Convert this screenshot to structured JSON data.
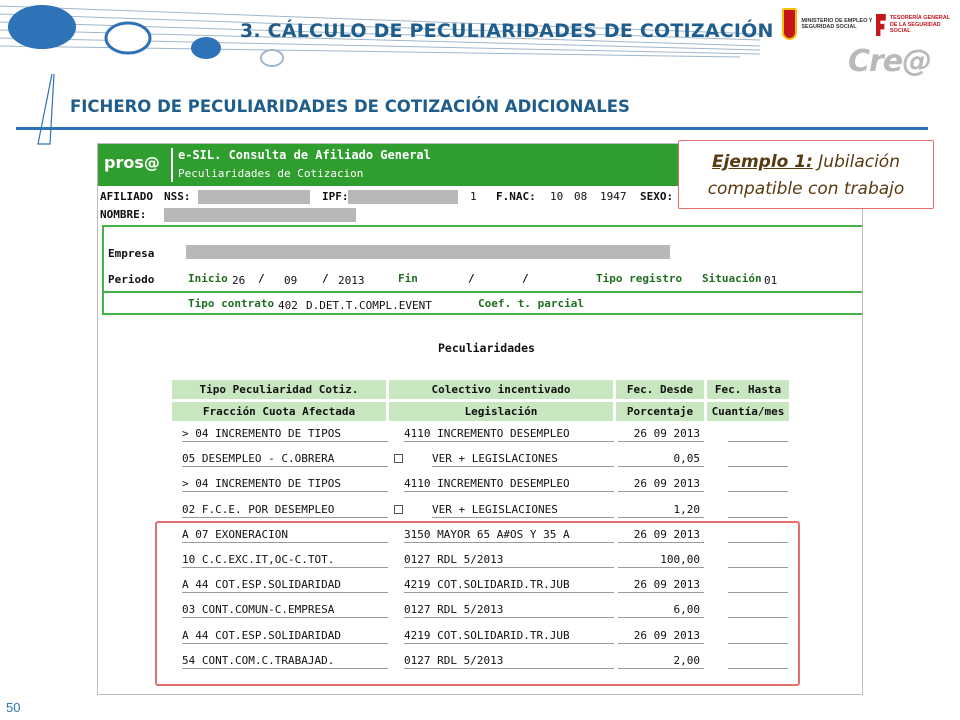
{
  "slide": {
    "title": "3.  CÁLCULO DE PECULIARIDADES DE COTIZACIÓN",
    "subtitle": "FICHERO DE PECULIARIDADES DE COTIZACIÓN ADICIONALES",
    "page_number": "50",
    "logo_ministry_text": "MINISTERIO DE EMPLEO Y SEGURIDAD SOCIAL",
    "logo_ss_text": "TESORERÍA GENERAL DE LA SEGURIDAD SOCIAL",
    "logo_crea": "Cre@"
  },
  "callout": {
    "label": "Ejemplo 1:",
    "text_1": "Jubilación",
    "text_2": "compatible con trabajo"
  },
  "app": {
    "brand": "pros@",
    "title": "e-SIL. Consulta de Afiliado General",
    "subtitle": "Peculiaridades de Cotizacion"
  },
  "affiliate": {
    "afiliado_label": "AFILIADO",
    "nss_label": "NSS:",
    "ipf_label": "IPF:",
    "ipf_suffix": "1",
    "fnac_label": "F.NAC:",
    "fnac_day": "10",
    "fnac_month": "08",
    "fnac_year": "1947",
    "sexo_label": "SEXO:",
    "nombre_label": "NOMBRE:"
  },
  "empresa": {
    "empresa_label": "Empresa",
    "periodo_label": "Periodo",
    "inicio_label": "Inicio",
    "inicio_day": "26",
    "inicio_month": "09",
    "inicio_year": "2013",
    "slash": "/",
    "fin_label": "Fin",
    "tipo_registro_label": "Tipo registro",
    "situacion_label": "Situación",
    "situacion_value": "01",
    "tipo_contrato_label": "Tipo contrato",
    "tipo_contrato_code": "402",
    "tipo_contrato_desc": "D.DET.T.COMPL.EVENT",
    "coef_label": "Coef. t. parcial"
  },
  "peculiaridades": {
    "title": "Peculiaridades",
    "headers_row1": [
      "Tipo Peculiaridad Cotiz.",
      "Colectivo incentivado",
      "Fec. Desde",
      "Fec. Hasta"
    ],
    "headers_row2": [
      "Fracción Cuota Afectada",
      "Legislación",
      "Porcentaje",
      "Cuantía/mes"
    ],
    "rows": [
      {
        "c1": "> 04 INCREMENTO DE TIPOS",
        "c2": "4110 INCREMENTO DESEMPLEO",
        "c3": "26 09 2013",
        "c4": "",
        "check": false
      },
      {
        "c1": "05 DESEMPLEO - C.OBRERA",
        "c2": "VER + LEGISLACIONES",
        "c3": "0,05",
        "c4": "",
        "check": true
      },
      {
        "c1": "> 04 INCREMENTO DE TIPOS",
        "c2": "4110 INCREMENTO DESEMPLEO",
        "c3": "26 09 2013",
        "c4": "",
        "check": false
      },
      {
        "c1": "02 F.C.E. POR DESEMPLEO",
        "c2": "VER + LEGISLACIONES",
        "c3": "1,20",
        "c4": "",
        "check": true
      },
      {
        "c1": "A 07 EXONERACION",
        "c2": "3150 MAYOR 65 A#OS Y 35 A",
        "c3": "26 09 2013",
        "c4": "",
        "check": false
      },
      {
        "c1": "10 C.C.EXC.IT,OC-C.TOT.",
        "c2": "0127 RDL 5/2013",
        "c3": "100,00",
        "c4": "",
        "check": false
      },
      {
        "c1": "A 44 COT.ESP.SOLIDARIDAD",
        "c2": "4219 COT.SOLIDARID.TR.JUB",
        "c3": "26 09 2013",
        "c4": "",
        "check": false
      },
      {
        "c1": "03 CONT.COMUN-C.EMPRESA",
        "c2": "0127 RDL 5/2013",
        "c3": "6,00",
        "c4": "",
        "check": false
      },
      {
        "c1": "A 44 COT.ESP.SOLIDARIDAD",
        "c2": "4219 COT.SOLIDARID.TR.JUB",
        "c3": "26 09 2013",
        "c4": "",
        "check": false
      },
      {
        "c1": "54 CONT.COM.C.TRABAJAD.",
        "c2": "0127 RDL 5/2013",
        "c3": "2,00",
        "c4": "",
        "check": false
      }
    ]
  },
  "colors": {
    "accent_blue": "#1f5d8c",
    "header_green": "#2f9e2f",
    "table_header_bg": "#c8e6c0",
    "highlight_red": "#e46d6d"
  }
}
